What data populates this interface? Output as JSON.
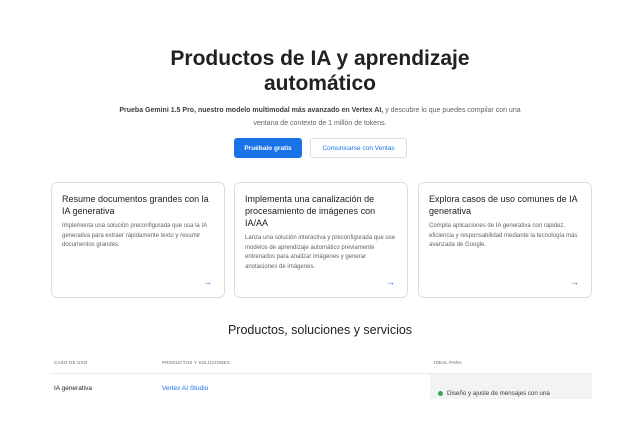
{
  "hero": {
    "title": "Productos de IA y aprendizaje automático",
    "subtitle_bold": "Prueba Gemini 1.5 Pro, nuestro modelo multimodal más avanzado en Vertex AI,",
    "subtitle_rest": " y descubre lo que puedes compilar con una ventana de contexto de 1 millón de tokens.",
    "primary_button": "Pruébalo gratis",
    "secondary_button": "Comunicarse con Ventas"
  },
  "cards": [
    {
      "title": "Resume documentos grandes con la IA generativa",
      "body": "Implementa una solución preconfigurada que usa la IA generativa para extraer rápidamente texto y resumir documentos grandes.",
      "arrow": "→"
    },
    {
      "title": "Implementa una canalización de procesamiento de imágenes con IA/AA",
      "body": "Lanza una solución interactiva y preconfigurada que use modelos de aprendizaje automático previamente entrenados para analizar imágenes y generar anotaciones de imágenes.",
      "arrow": "→"
    },
    {
      "title": "Explora casos de uso comunes de IA generativa",
      "body": "Compila aplicaciones de IA generativa con rapidez, eficiencia y responsabilidad mediante la tecnología más avanzada de Google.",
      "arrow": "→"
    }
  ],
  "section": {
    "title": "Productos, soluciones y servicios"
  },
  "table": {
    "headers": [
      "CASO DE USO",
      "PRODUCTOS Y SOLUCIONES",
      "IDEAL PARA"
    ],
    "row": {
      "use_case": "IA generativa",
      "product": "Vertex AI Studio",
      "ideal": "Diseño y ajuste de mensajes con una"
    }
  },
  "colors": {
    "accent": "#1a73e8",
    "bullet": "#34a853"
  }
}
